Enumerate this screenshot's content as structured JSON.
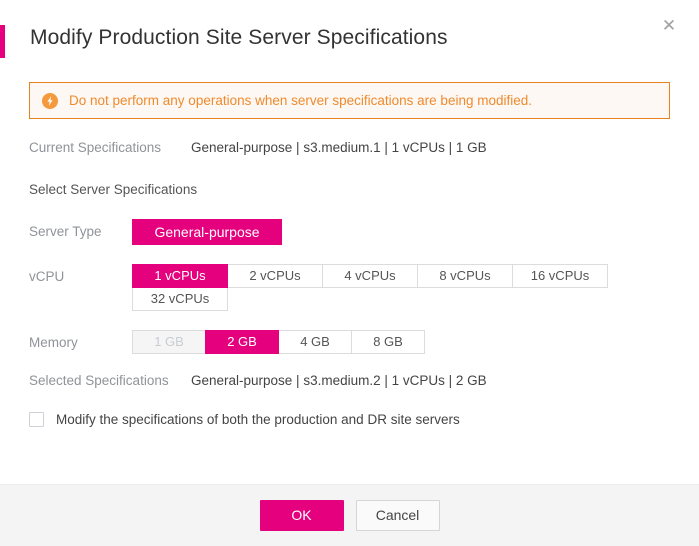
{
  "dialog": {
    "title": "Modify Production Site Server Specifications",
    "close_icon": "close-icon",
    "accent_color": "#e5007d"
  },
  "alert": {
    "icon": "warning-circle-icon",
    "text": "Do not perform any operations when server specifications are being modified.",
    "border_color": "#e8821e",
    "text_color": "#f08a2e",
    "background_color": "#fdf8f3"
  },
  "current_specifications": {
    "label": "Current Specifications",
    "value": "General-purpose | s3.medium.1 | 1 vCPUs | 1 GB"
  },
  "section": {
    "title": "Select Server Specifications"
  },
  "server_type": {
    "label": "Server Type",
    "options": [
      {
        "label": "General-purpose",
        "selected": true,
        "disabled": false
      }
    ]
  },
  "vcpu": {
    "label": "vCPU",
    "options": [
      {
        "label": "1 vCPUs",
        "selected": true,
        "disabled": false
      },
      {
        "label": "2 vCPUs",
        "selected": false,
        "disabled": false
      },
      {
        "label": "4 vCPUs",
        "selected": false,
        "disabled": false
      },
      {
        "label": "8 vCPUs",
        "selected": false,
        "disabled": false
      },
      {
        "label": "16 vCPUs",
        "selected": false,
        "disabled": false
      },
      {
        "label": "32 vCPUs",
        "selected": false,
        "disabled": false
      }
    ]
  },
  "memory": {
    "label": "Memory",
    "options": [
      {
        "label": "1 GB",
        "selected": false,
        "disabled": true
      },
      {
        "label": "2 GB",
        "selected": true,
        "disabled": false
      },
      {
        "label": "4 GB",
        "selected": false,
        "disabled": false
      },
      {
        "label": "8 GB",
        "selected": false,
        "disabled": false
      }
    ]
  },
  "selected_specifications": {
    "label": "Selected Specifications",
    "value": "General-purpose | s3.medium.2 | 1 vCPUs | 2 GB"
  },
  "dr_checkbox": {
    "label": "Modify the specifications of both the production and DR site servers",
    "checked": false
  },
  "footer": {
    "ok_label": "OK",
    "cancel_label": "Cancel"
  }
}
